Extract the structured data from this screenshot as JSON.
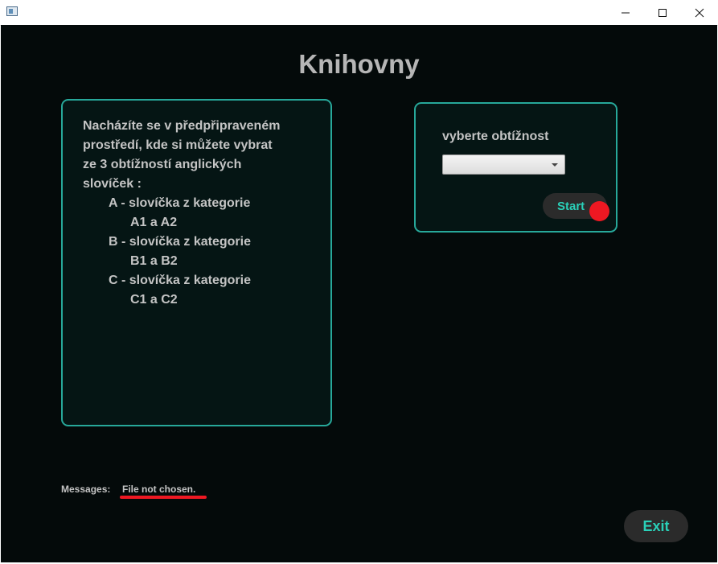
{
  "window": {
    "controls": {
      "minimize_icon": "minimize-icon",
      "maximize_icon": "maximize-icon",
      "close_icon": "close-icon"
    }
  },
  "header": {
    "title": "Knihovny"
  },
  "info": {
    "intro": [
      "Nacházíte se v předpřipraveném",
      "prostředí, kde si můžete vybrat",
      "ze 3 obtížností anglických",
      "slovíček :"
    ],
    "levels": [
      {
        "label": "A - slovíčka z kategorie",
        "range": "A1 a A2"
      },
      {
        "label": "B - slovíčka z kategorie",
        "range": "B1 a B2"
      },
      {
        "label": "C - slovíčka z kategorie",
        "range": "C1 a C2"
      }
    ]
  },
  "difficulty": {
    "label": "vyberte obtížnost",
    "selected": "",
    "start_label": "Start"
  },
  "messages": {
    "label": "Messages:",
    "text": "File not chosen."
  },
  "footer": {
    "exit_label": "Exit"
  },
  "colors": {
    "background": "#040a0a",
    "panel": "#051514",
    "accent": "#27a89a",
    "button_text": "#2ad0b8",
    "annotation_red": "#ee1822"
  }
}
